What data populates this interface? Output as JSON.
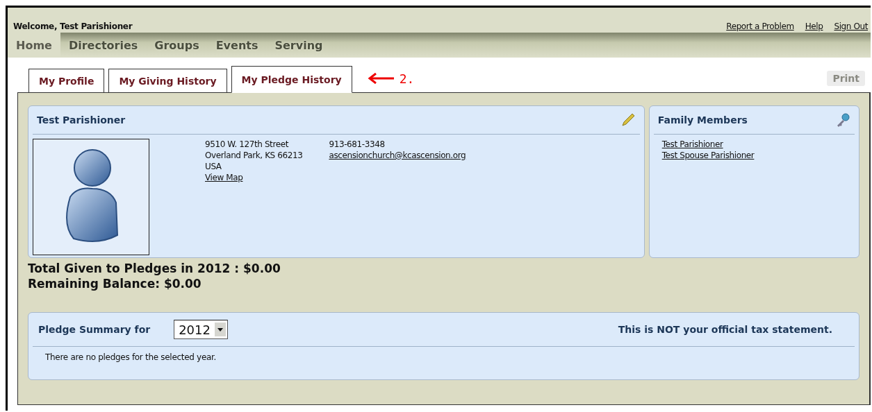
{
  "header": {
    "welcome": "Welcome, Test Parishioner",
    "links": [
      "Report a Problem",
      "Help",
      "Sign Out"
    ]
  },
  "nav": [
    {
      "label": "Home",
      "selected": true
    },
    {
      "label": "Directories",
      "selected": false
    },
    {
      "label": "Groups",
      "selected": false
    },
    {
      "label": "Events",
      "selected": false
    },
    {
      "label": "Serving",
      "selected": false
    }
  ],
  "tabs": [
    {
      "label": "My Profile",
      "selected": false
    },
    {
      "label": "My Giving History",
      "selected": false
    },
    {
      "label": "My Pledge History",
      "selected": true
    }
  ],
  "annotation": {
    "label": "2."
  },
  "print": "Print",
  "profile": {
    "name": "Test Parishioner",
    "address": [
      "9510 W. 127th Street",
      "Overland Park, KS 66213",
      "USA"
    ],
    "map_link": "View Map",
    "phone": "913-681-3348",
    "email": "ascensionchurch@kcascension.org"
  },
  "family": {
    "title": "Family Members",
    "members": [
      "Test Parishioner",
      "Test Spouse Parishioner"
    ]
  },
  "totals": [
    "Total Given to Pledges in 2012 : $0.00",
    "Remaining Balance: $0.00"
  ],
  "summary": {
    "title": "Pledge Summary for",
    "year": "2012",
    "notice": "This is NOT your official tax statement.",
    "message": "There are no pledges for the selected year."
  }
}
